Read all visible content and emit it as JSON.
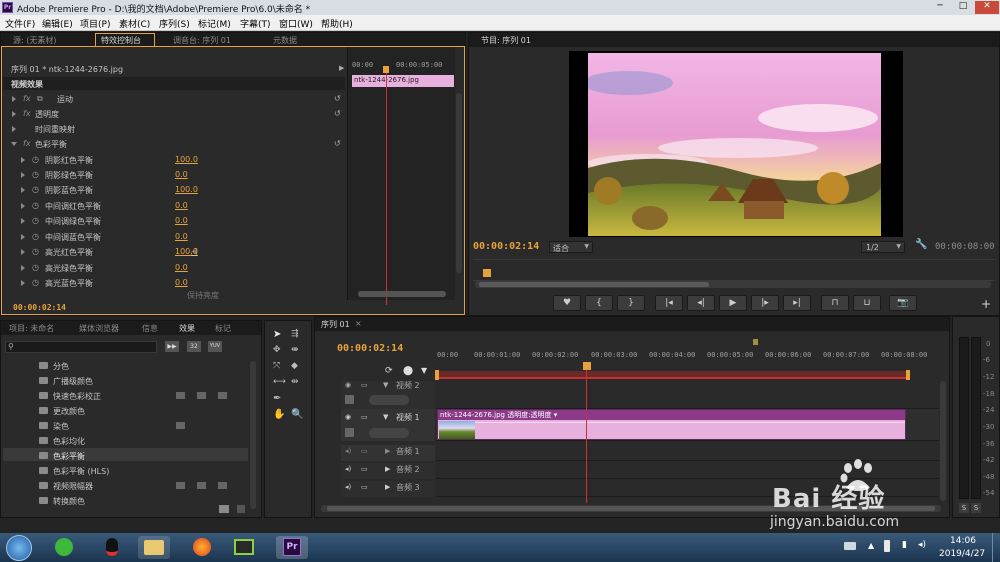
{
  "window": {
    "title": "Adobe Premiere Pro - D:\\我的文档\\Adobe\\Premiere Pro\\6.0\\未命名 *",
    "app_icon": "Pr"
  },
  "menu": [
    "文件(F)",
    "编辑(E)",
    "项目(P)",
    "素材(C)",
    "序列(S)",
    "标记(M)",
    "字幕(T)",
    "窗口(W)",
    "帮助(H)"
  ],
  "source_tabs": [
    "源: (无素材)",
    "特效控制台",
    "调音台: 序列 01",
    "元数据"
  ],
  "effect_controls": {
    "clip_label": "序列 01 * ntk-1244-2676.jpg",
    "ruler_start": "00:00",
    "ruler_mid": "00:00:05:00",
    "clip_name": "ntk-1244-2676.jpg",
    "video_effects_header": "视频效果",
    "effects": [
      "运动",
      "透明度",
      "时间重映射",
      "色彩平衡"
    ],
    "params": [
      {
        "label": "阴影红色平衡",
        "value": "100.0"
      },
      {
        "label": "阴影绿色平衡",
        "value": "0.0"
      },
      {
        "label": "阴影蓝色平衡",
        "value": "100.0"
      },
      {
        "label": "中间调红色平衡",
        "value": "0.0"
      },
      {
        "label": "中间调绿色平衡",
        "value": "0.0"
      },
      {
        "label": "中间调蓝色平衡",
        "value": "0.0"
      },
      {
        "label": "高光红色平衡",
        "value": "100.0"
      },
      {
        "label": "高光绿色平衡",
        "value": "0.0"
      },
      {
        "label": "高光蓝色平衡",
        "value": "0.0"
      }
    ],
    "cut_off_param": "保持亮度",
    "timecode": "00:00:02:14"
  },
  "program": {
    "tab": "节目: 序列 01",
    "timecode": "00:00:02:14",
    "fit": "适合",
    "resolution": "1/2",
    "duration": "00:00:08:00"
  },
  "project_tabs": [
    "项目: 未命名",
    "媒体浏览器",
    "信息",
    "效果",
    "标记"
  ],
  "effects_list": [
    "分色",
    "广播级颜色",
    "快速色彩校正",
    "更改颜色",
    "染色",
    "色彩均化",
    "色彩平衡",
    "色彩平衡 (HLS)",
    "视频限幅器",
    "转换颜色"
  ],
  "effects_badges": [
    "32",
    "YUV"
  ],
  "timeline": {
    "tab": "序列 01",
    "timecode": "00:00:02:14",
    "ruler": [
      "00:00",
      "00:00:01:00",
      "00:00:02:00",
      "00:00:03:00",
      "00:00:04:00",
      "00:00:05:00",
      "00:00:06:00",
      "00:00:07:00",
      "00:00:08:00"
    ],
    "tracks": {
      "video2": "视频 2",
      "video1": "视频 1",
      "audio1": "音频 1",
      "audio2": "音频 2",
      "audio3": "音频 3"
    },
    "clip_label": "ntk-1244-2676.jpg  透明度:透明度 ▾"
  },
  "vu_scale": [
    "0",
    "-6",
    "-12",
    "-18",
    "-24",
    "-30",
    "-36",
    "-42",
    "-48",
    "-54"
  ],
  "vu_solo": "S",
  "taskbar": {
    "time": "14:06",
    "date": "2019/4/27"
  },
  "watermark": {
    "brand": "Bai 经验",
    "url": "jingyan.baidu.com"
  },
  "colors": {
    "accent": "#e8a23c",
    "playhead": "#d03030",
    "clip": "#e8b0dc"
  }
}
